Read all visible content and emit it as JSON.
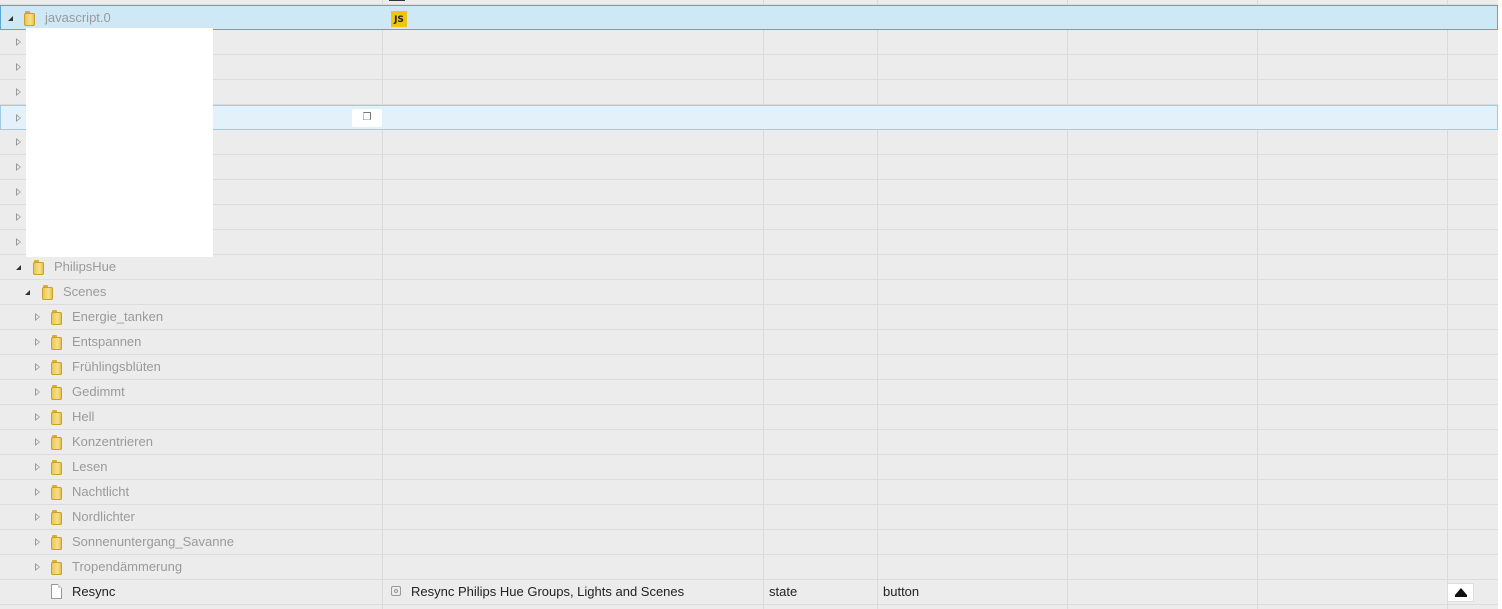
{
  "root": {
    "label": "javascript.0",
    "role_icon": "JS"
  },
  "collapsed_rows_count_hidden": "",
  "copy_icon": "copy-icon",
  "tree": {
    "philipshue": "PhilipsHue",
    "scenes": "Scenes",
    "scene_items": [
      "Energie_tanken",
      "Entspannen",
      "Frühlingsblüten",
      "Gedimmt",
      "Hell",
      "Konzentrieren",
      "Lesen",
      "Nachtlicht",
      "Nordlichter",
      "Sonnenuntergang_Savanne",
      "Tropendämmerung"
    ],
    "resync": {
      "label": "Resync",
      "name": "Resync Philips Hue Groups, Lights and Scenes",
      "type": "state",
      "role": "button"
    }
  },
  "colors": {
    "selected_row": "#cfe8f6",
    "hover_row": "#e3f1fa",
    "background": "#ececec",
    "folder": "#f1d46a",
    "js_badge": "#f1c40f"
  }
}
